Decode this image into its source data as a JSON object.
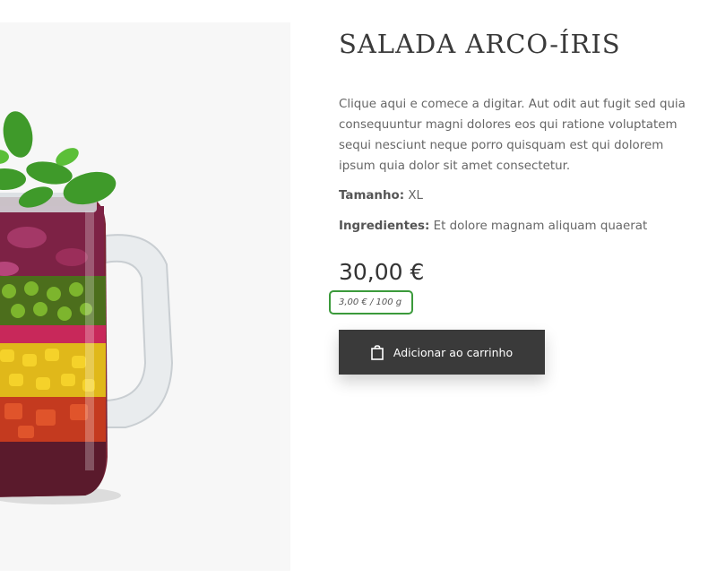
{
  "product": {
    "title": "SALADA ARCO-ÍRIS",
    "description": "Clique aqui e comece a digitar. Aut odit aut fugit sed quia consequuntur magni dolores eos qui ratione voluptatem sequi nesciunt neque porro quisquam est qui dolorem ipsum quia dolor sit amet consectetur.",
    "size_label": "Tamanho:",
    "size_value": "XL",
    "ingredients_label": "Ingredientes:",
    "ingredients_value": "Et dolore magnam aliquam quaerat",
    "price": "30,00 €",
    "unit_price": "3,00 € / 100 g",
    "add_to_cart_label": "Adicionar ao carrinho",
    "add_to_cart_icon": "shopping-bag-icon",
    "image": "salad-jar"
  },
  "colors": {
    "button_bg": "#3a3a3a",
    "highlight_border": "#3b9a3b",
    "image_bg": "#f7f7f7"
  }
}
